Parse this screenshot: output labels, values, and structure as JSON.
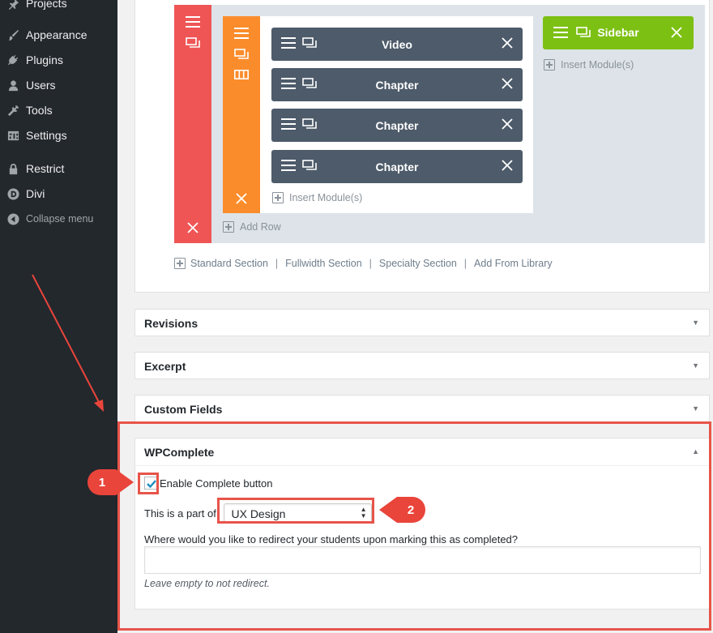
{
  "sidebar": {
    "items": [
      {
        "label": "Projects",
        "icon": "pin-icon"
      },
      {
        "label": "Appearance",
        "icon": "paintbrush-icon"
      },
      {
        "label": "Plugins",
        "icon": "plugin-icon"
      },
      {
        "label": "Users",
        "icon": "users-icon"
      },
      {
        "label": "Tools",
        "icon": "wrench-icon"
      },
      {
        "label": "Settings",
        "icon": "settings-icon"
      },
      {
        "label": "Restrict",
        "icon": "lock-icon"
      },
      {
        "label": "Divi",
        "icon": "divi-icon"
      },
      {
        "label": "Collapse menu",
        "icon": "collapse-icon"
      }
    ]
  },
  "builder": {
    "modules": [
      "Video",
      "Chapter",
      "Chapter",
      "Chapter"
    ],
    "sidebar_module": "Sidebar",
    "insert_modules_label": "Insert Module(s)",
    "add_row_label": "Add Row",
    "footer_links": [
      "Standard Section",
      "Fullwidth Section",
      "Specialty Section",
      "Add From Library"
    ],
    "colors": {
      "section": "#ef5555",
      "row": "#fb8c2b",
      "module": "#4d5b6a",
      "sidebar": "#7dc014"
    }
  },
  "postboxes": {
    "revisions": "Revisions",
    "excerpt": "Excerpt",
    "custom_fields": "Custom Fields"
  },
  "wpcomplete": {
    "title": "WPComplete",
    "enable_label": "Enable Complete button",
    "enable_checked": true,
    "part_label": "This is a part of:",
    "part_value": "UX Design",
    "redirect_label": "Where would you like to redirect your students upon marking this as completed?",
    "redirect_value": "",
    "redirect_hint": "Leave empty to not redirect."
  },
  "annotations": {
    "callout_1": "1",
    "callout_2": "2",
    "accent": "#e9453b"
  }
}
